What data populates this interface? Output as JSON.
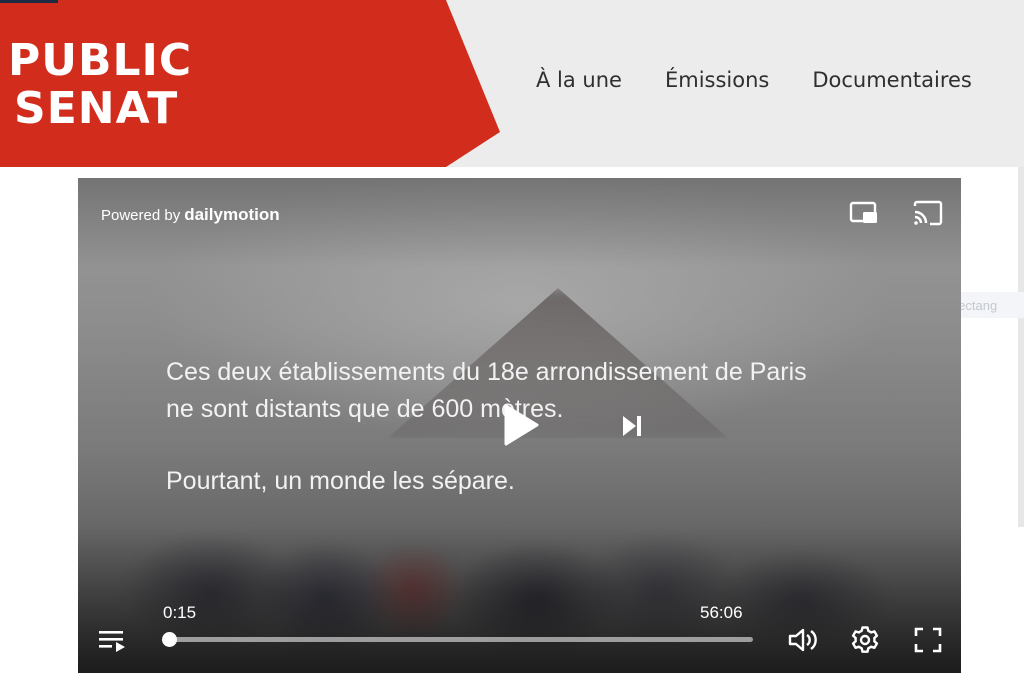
{
  "colors": {
    "brand_red": "#d22c1c",
    "header_bg": "#ececec"
  },
  "header": {
    "logo": {
      "line1": "PUBLIC",
      "line2": "SENAT"
    },
    "nav": [
      {
        "label": "À la une"
      },
      {
        "label": "Émissions"
      },
      {
        "label": "Documentaires"
      }
    ]
  },
  "overlay": {
    "capture_label": "Capture rectang"
  },
  "player": {
    "powered_by": "Powered by",
    "provider": "dailymotion",
    "caption_lines": [
      "Ces deux établissements du 18e arrondissement de Paris",
      "ne sont distants que de 600 mètres.",
      "Pourtant, un monde les sépare."
    ],
    "current_time": "0:15",
    "duration": "56:06",
    "progress_fraction": 0.0045,
    "icons": {
      "pip": "picture-in-picture-icon",
      "cast": "cast-icon",
      "play": "play-icon",
      "next": "skip-next-icon",
      "playlist": "playlist-icon",
      "volume": "volume-icon",
      "settings": "gear-icon",
      "fullscreen": "fullscreen-icon"
    }
  }
}
